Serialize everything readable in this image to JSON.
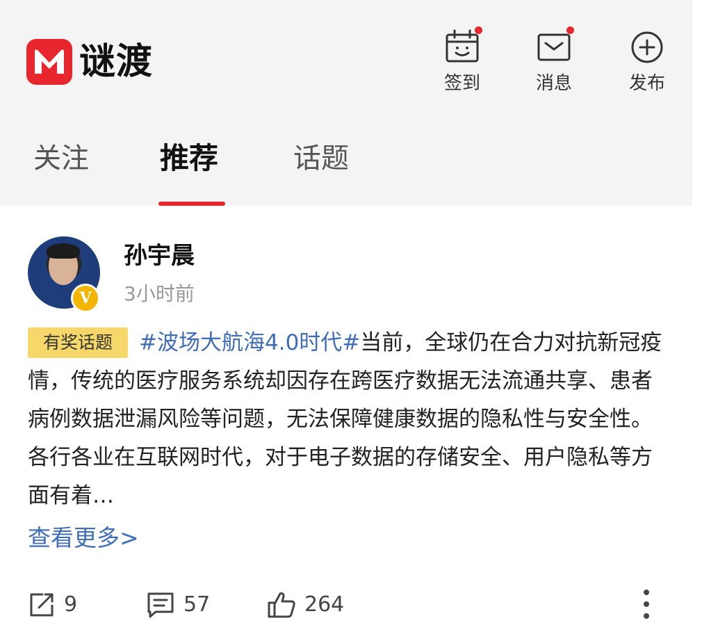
{
  "app": {
    "name": "谜渡",
    "brand_color": "#e8262d"
  },
  "header": {
    "actions": [
      {
        "label": "签到",
        "icon": "calendar-checkin-icon",
        "has_badge_dot": true
      },
      {
        "label": "消息",
        "icon": "envelope-icon",
        "has_badge_dot": true
      },
      {
        "label": "发布",
        "icon": "plus-circle-icon",
        "has_badge_dot": false
      }
    ]
  },
  "tabs": [
    {
      "label": "关注",
      "active": false
    },
    {
      "label": "推荐",
      "active": true
    },
    {
      "label": "话题",
      "active": false
    }
  ],
  "post": {
    "author": "孙宇晨",
    "verified_badge": "V",
    "time": "3小时前",
    "reward_tag": "有奖话题",
    "topic": "#波场大航海4.0时代#",
    "content": "当前，全球仍在合力对抗新冠疫情，传统的医疗服务系统却因存在跨医疗数据无法流通共享、患者病例数据泄漏风险等问题，无法保障健康数据的隐私性与安全性。各行各业在互联网时代，对于电子数据的存储安全、用户隐私等方面有着…",
    "read_more": "查看更多>",
    "stats": {
      "shares": "9",
      "comments": "57",
      "likes": "264"
    }
  },
  "colors": {
    "link": "#3f6db8",
    "reward_tag_bg": "#f6d86a",
    "verified_badge": "#f2b600"
  }
}
